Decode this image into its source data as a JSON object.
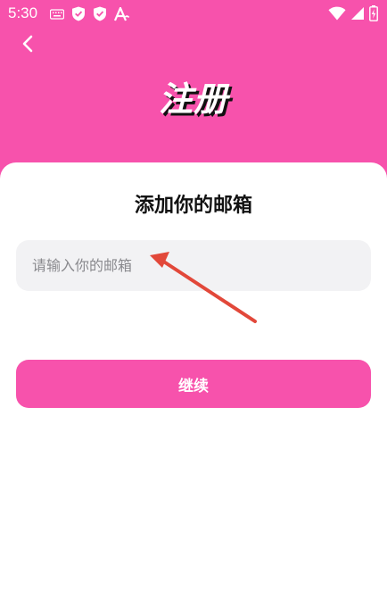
{
  "status_bar": {
    "time": "5:30",
    "left_icons": [
      "keyboard-icon",
      "shield-check-icon",
      "shield-check-icon",
      "font-a-icon"
    ],
    "right_icons": [
      "wifi-icon",
      "signal-icon",
      "battery-icon"
    ]
  },
  "header": {
    "title": "注册",
    "background_color": "#f752ac"
  },
  "form": {
    "heading": "添加你的邮箱",
    "email_placeholder": "请输入你的邮箱",
    "email_value": "",
    "continue_label": "继续",
    "accent_color": "#f752ac"
  },
  "annotation": {
    "arrow_color": "#e2483a"
  }
}
